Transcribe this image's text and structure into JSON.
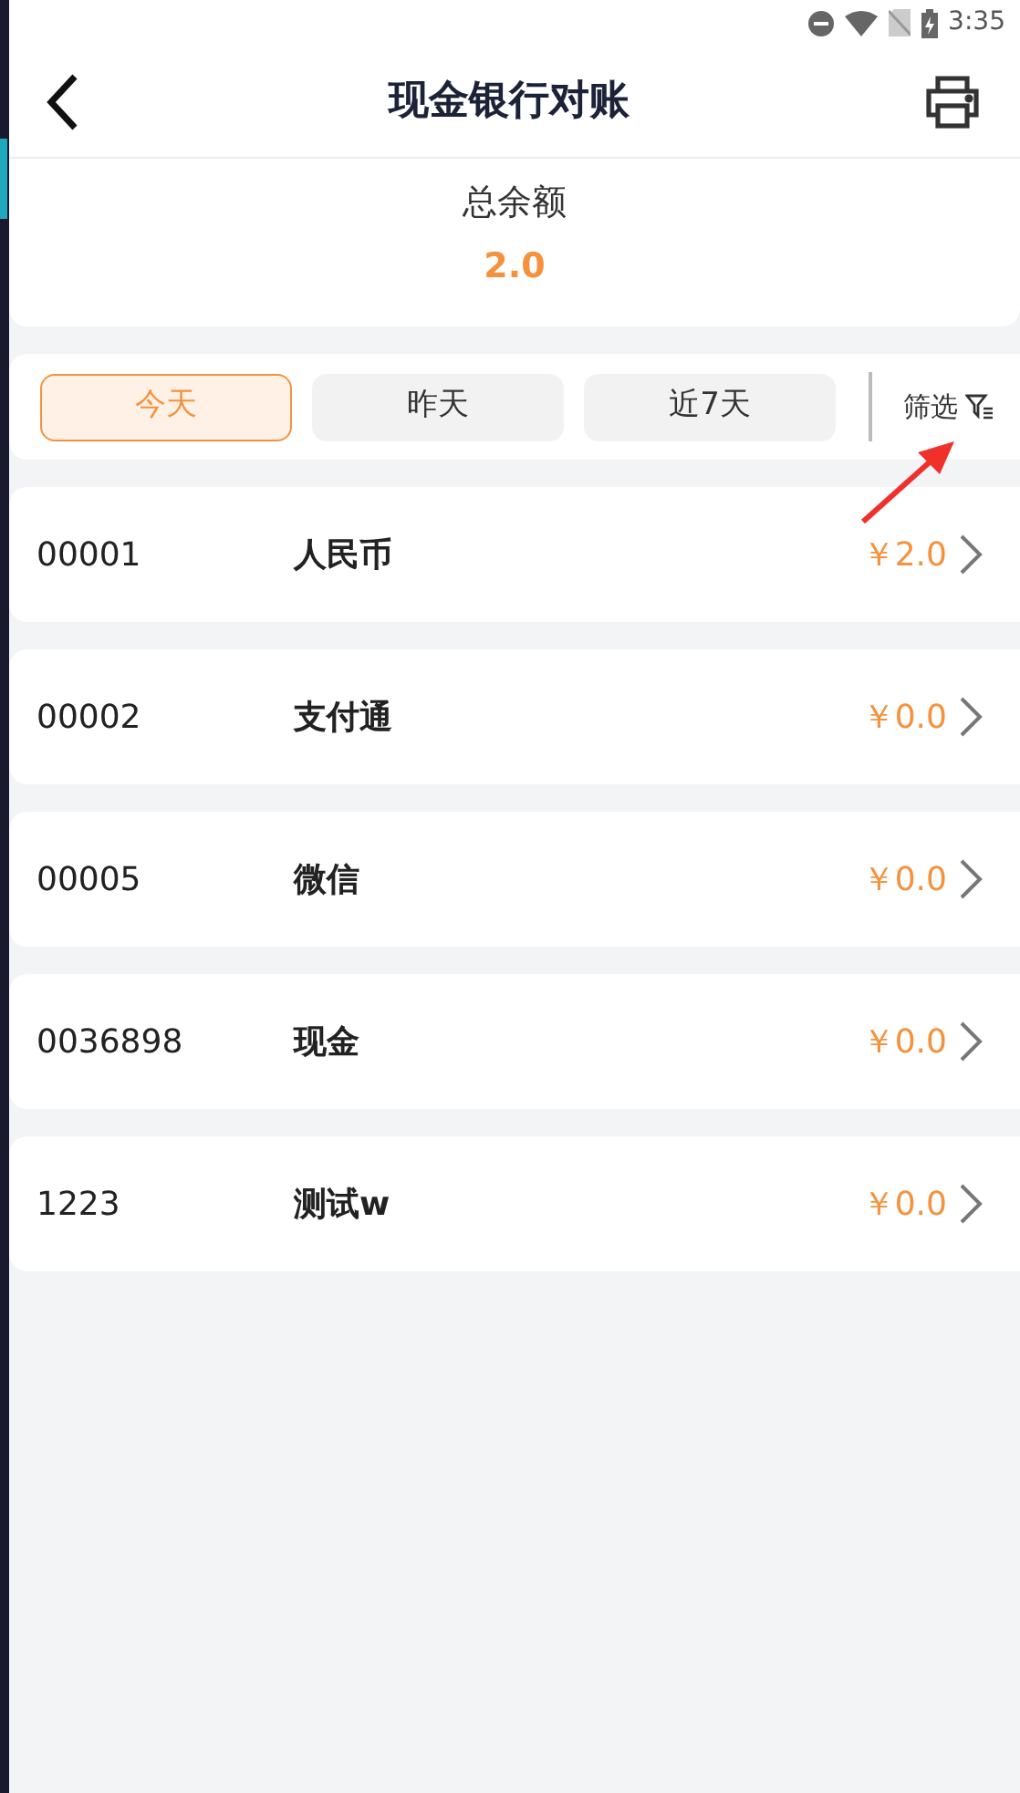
{
  "status_bar": {
    "time": "3:35"
  },
  "header": {
    "title": "现金银行对账"
  },
  "balance": {
    "label": "总余额",
    "amount": "2.0"
  },
  "tabs": [
    {
      "label": "今天",
      "selected": true
    },
    {
      "label": "昨天",
      "selected": false
    },
    {
      "label": "近7天",
      "selected": false
    }
  ],
  "filter": {
    "label": "筛选"
  },
  "accounts": [
    {
      "code": "00001",
      "name": "人民币",
      "amount": "￥2.0"
    },
    {
      "code": "00002",
      "name": "支付通",
      "amount": "￥0.0"
    },
    {
      "code": "00005",
      "name": "微信",
      "amount": "￥0.0"
    },
    {
      "code": "0036898",
      "name": "现金",
      "amount": "￥0.0"
    },
    {
      "code": "1223",
      "name": "测试w",
      "amount": "￥0.0"
    }
  ]
}
